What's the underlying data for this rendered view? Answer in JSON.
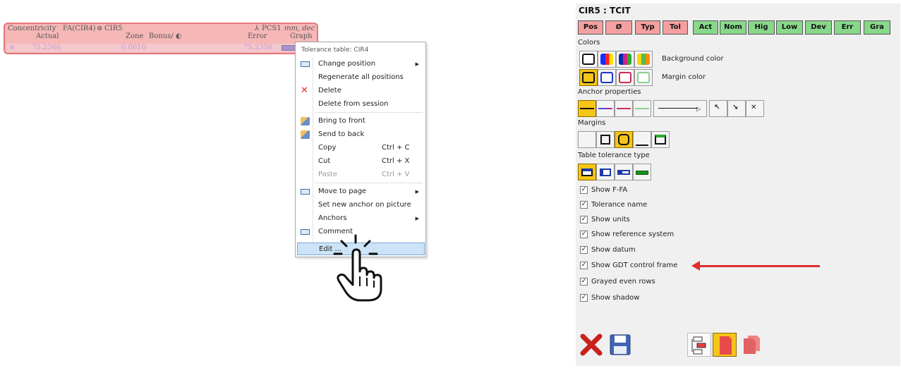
{
  "tolerance_table": {
    "title": "Concentricity",
    "fa": "FA(CIR4)",
    "target": "CIR5",
    "ref": "PCS1",
    "units": "mm, dec",
    "headers": {
      "actual": "Actual",
      "zone": "Zone",
      "bonus": "Bonus/",
      "error": "Error",
      "graph": "Graph"
    },
    "row": {
      "actual": "75.2366",
      "zone": "0.0010",
      "error": "75.2356"
    }
  },
  "context_menu": {
    "header": "Tolerance table: CIR4",
    "items": [
      {
        "label": "Change position",
        "shortcut": "",
        "submenu": true,
        "icon": "panel-icon"
      },
      {
        "label": "Regenerate all positions",
        "shortcut": "",
        "submenu": false,
        "icon": ""
      },
      {
        "label": "Delete",
        "shortcut": "",
        "submenu": false,
        "icon": "delete-x-icon"
      },
      {
        "label": "Delete from session",
        "shortcut": "",
        "submenu": false,
        "icon": ""
      },
      {
        "label": "Bring to front",
        "shortcut": "",
        "submenu": false,
        "icon": "bring-front-icon"
      },
      {
        "label": "Send to back",
        "shortcut": "",
        "submenu": false,
        "icon": "send-back-icon"
      },
      {
        "label": "Copy",
        "shortcut": "Ctrl + C",
        "submenu": false,
        "icon": ""
      },
      {
        "label": "Cut",
        "shortcut": "Ctrl + X",
        "submenu": false,
        "icon": ""
      },
      {
        "label": "Paste",
        "shortcut": "Ctrl + V",
        "submenu": false,
        "disabled": true,
        "icon": ""
      },
      {
        "label": "Move to page",
        "shortcut": "",
        "submenu": true,
        "icon": "panel-icon"
      },
      {
        "label": "Set new anchor on picture",
        "shortcut": "",
        "submenu": false,
        "icon": ""
      },
      {
        "label": "Anchors",
        "shortcut": "",
        "submenu": true,
        "icon": ""
      },
      {
        "label": "Comment",
        "shortcut": "",
        "submenu": false,
        "icon": "panel-icon"
      },
      {
        "label": "Edit ...",
        "shortcut": "",
        "submenu": false,
        "highlighted": true,
        "icon": ""
      }
    ]
  },
  "panel": {
    "title": "CIR5 : TCIT",
    "tabs": [
      {
        "label": "Pos",
        "state": "red"
      },
      {
        "label": "Ø",
        "state": "red"
      },
      {
        "label": "Typ",
        "state": "red"
      },
      {
        "label": "Tol",
        "state": "red"
      },
      {
        "label": "Act",
        "state": "green"
      },
      {
        "label": "Nom",
        "state": "green"
      },
      {
        "label": "Hig",
        "state": "green"
      },
      {
        "label": "Low",
        "state": "green"
      },
      {
        "label": "Dev",
        "state": "green"
      },
      {
        "label": "Err",
        "state": "green"
      },
      {
        "label": "Gra",
        "state": "green"
      }
    ],
    "colors_label": "Colors",
    "background_color_label": "Background color",
    "margin_color_label": "Margin color",
    "anchor_label": "Anchor properties",
    "margins_label": "Margins",
    "table_type_label": "Table tolerance type",
    "checkboxes": [
      {
        "label": "Show F-FA",
        "checked": true
      },
      {
        "label": "Tolerance name",
        "checked": true
      },
      {
        "label": "Show units",
        "checked": true
      },
      {
        "label": "Show reference system",
        "checked": true
      },
      {
        "label": "Show datum",
        "checked": true
      },
      {
        "label": "Show GDT control frame",
        "checked": true
      },
      {
        "label": "Grayed even rows",
        "checked": true
      },
      {
        "label": "Show shadow",
        "checked": true
      }
    ],
    "accent_colors": {
      "red_tab": "#f4a0a0",
      "green_tab": "#88d88a",
      "selected": "#f5c518",
      "arrow": "#e02d2d"
    }
  }
}
